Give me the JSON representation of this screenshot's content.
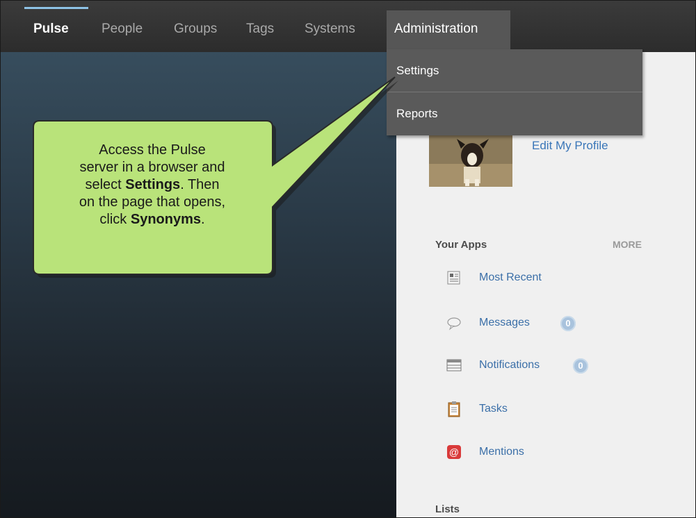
{
  "nav": {
    "items": [
      "Pulse",
      "People",
      "Groups",
      "Tags",
      "Systems"
    ],
    "admin_label": "Administration"
  },
  "dropdown": {
    "items": [
      "Settings",
      "Reports"
    ]
  },
  "profile": {
    "edit_label": "Edit My Profile"
  },
  "apps": {
    "heading": "Your Apps",
    "more_label": "MORE",
    "items": [
      {
        "label": "Most Recent",
        "icon": "newspaper-icon"
      },
      {
        "label": "Messages",
        "icon": "speech-bubble-icon",
        "badge": "0"
      },
      {
        "label": "Notifications",
        "icon": "notifications-list-icon",
        "badge": "0"
      },
      {
        "label": "Tasks",
        "icon": "clipboard-icon"
      },
      {
        "label": "Mentions",
        "icon": "at-sign-icon"
      }
    ]
  },
  "lists": {
    "heading": "Lists"
  },
  "callout": {
    "line1": "Access the Pulse",
    "line2": "server in a browser and",
    "line3_pre": "select ",
    "line3_bold": "Settings",
    "line3_post": ". Then",
    "line4": "on the page that opens,",
    "line5_pre": "click ",
    "line5_bold": "Synonyms",
    "line5_post": "."
  },
  "colors": {
    "nav_bg": "#333333",
    "active_indicator": "#8ec3e6",
    "dropdown_bg": "#5a5a5a",
    "callout_fill": "#b9e37a",
    "link": "#3b6fa8",
    "badge": "#a9c3dd"
  }
}
